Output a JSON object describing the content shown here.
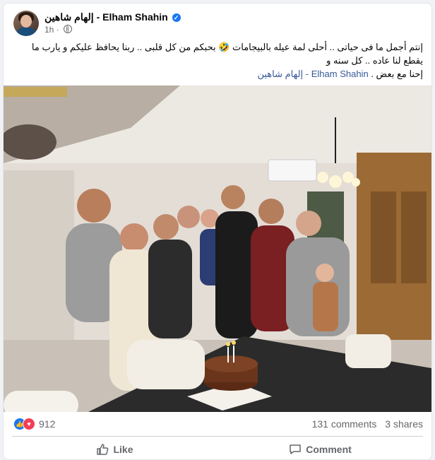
{
  "post": {
    "author": "إلهام شاهين - Elham Shahin",
    "time": "1h",
    "text_line1": "إنتم أجمل ما فى حياتى .. أحلى لمة عيله بالبيجامات 🤣 بحبكم من كل قلبى .. ربنا يحافظ عليكم و يارب ما يقطع لنا عاده .. كل سنه و",
    "text_line2": "إحنا مع بعض .",
    "tag": "Elham Shahin - إلهام شاهين"
  },
  "engagement": {
    "reaction_count": "912",
    "comments": "131 comments",
    "shares": "3 shares",
    "reaction_icons": [
      "like-icon",
      "love-icon"
    ]
  },
  "actions": {
    "like_label": "Like",
    "comment_label": "Comment"
  },
  "colors": {
    "link": "#385898",
    "brand": "#1877f2",
    "love": "#f33e58"
  }
}
